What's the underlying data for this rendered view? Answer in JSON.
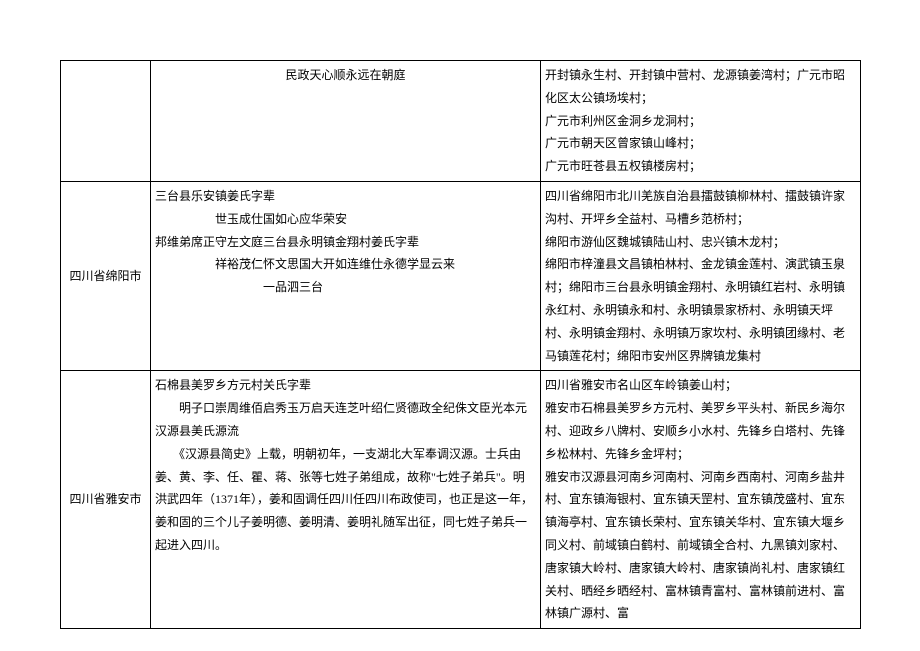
{
  "rows": [
    {
      "col0": "",
      "col1_lines": [
        "民政天心顺永远在朝庭"
      ],
      "col1_align": "center",
      "col2_lines": [
        "开封镇永生村、开封镇中营村、龙源镇姜湾村；广元市昭化区太公镇场埃村；",
        "广元市利州区金洞乡龙洞村；",
        "广元市朝天区曾家镇山峰村；",
        "广元市旺苍县五权镇楼房村；"
      ]
    },
    {
      "col0": "四川省绵阳市",
      "col1_lines": [
        "三台县乐安镇姜氏字辈",
        "　　　　　世玉成仕国如心应华荣安",
        "邦维弟席正守左文庭三台县永明镇金翔村姜氏字辈",
        "　　　　　祥裕茂仁怀文思国大开如连维仕永德学显云来",
        "　　　　　　　　　一品泗三台"
      ],
      "col1_align": "left",
      "col2_lines": [
        "四川省绵阳市北川羌族自治县擂鼓镇柳林村、擂鼓镇许家沟村、开坪乡全益村、马槽乡范桥村；",
        "绵阳市游仙区魏城镇陆山村、忠兴镇木龙村；",
        "绵阳市梓潼县文昌镇柏林村、金龙镇金莲村、演武镇玉泉村；绵阳市三台县永明镇金翔村、永明镇红岩村、永明镇永红村、永明镇永和村、永明镇景家桥村、永明镇天坪村、永明镇金翔村、永明镇万家坎村、永明镇团缘村、老马镇莲花村；绵阳市安州区界牌镇龙集村"
      ]
    },
    {
      "col0": "四川省雅安市",
      "col1_lines": [
        "石棉县美罗乡方元村关氏字辈",
        "　　明子口崇周维佰启秀玉万启天连芝叶绍仁贤德政全纪侏文臣光本元汉源县美氏源流",
        "　　《汉源县简史》上载，明朝初年，一支湖北大军奉调汉源。士兵由姜、黄、李、任、瞿、蒋、张等七姓子弟组成，故称\"七姓子弟兵\"。明洪武四年（1371年），姜和固调任四川任四川布政使司，也正是这一年，姜和固的三个儿子姜明德、姜明清、姜明礼随军出征，同七姓子弟兵一起进入四川。"
      ],
      "col1_align": "left",
      "col2_lines": [
        "四川省雅安市名山区车岭镇姜山村；",
        "雅安市石棉县美罗乡方元村、美罗乡平头村、新民乡海尔村、迎政乡八牌村、安顺乡小水村、先锋乡白塔村、先锋乡松林村、先锋乡金坪村；",
        "雅安市汉源县河南乡河南村、河南乡西南村、河南乡盐井村、宜东镇海银村、宜东镇天罡村、宜东镇茂盛村、宜东镇海亭村、宜东镇长荣村、宜东镇关华村、宜东镇大堰乡同义村、前域镇白鹤村、前域镇全合村、九黑镇刘家村、唐家镇大岭村、唐家镇大岭村、唐家镇尚礼村、唐家镇红关村、晒经乡晒经村、富林镇青富村、富林镇前进村、富林镇广源村、富"
      ]
    }
  ]
}
